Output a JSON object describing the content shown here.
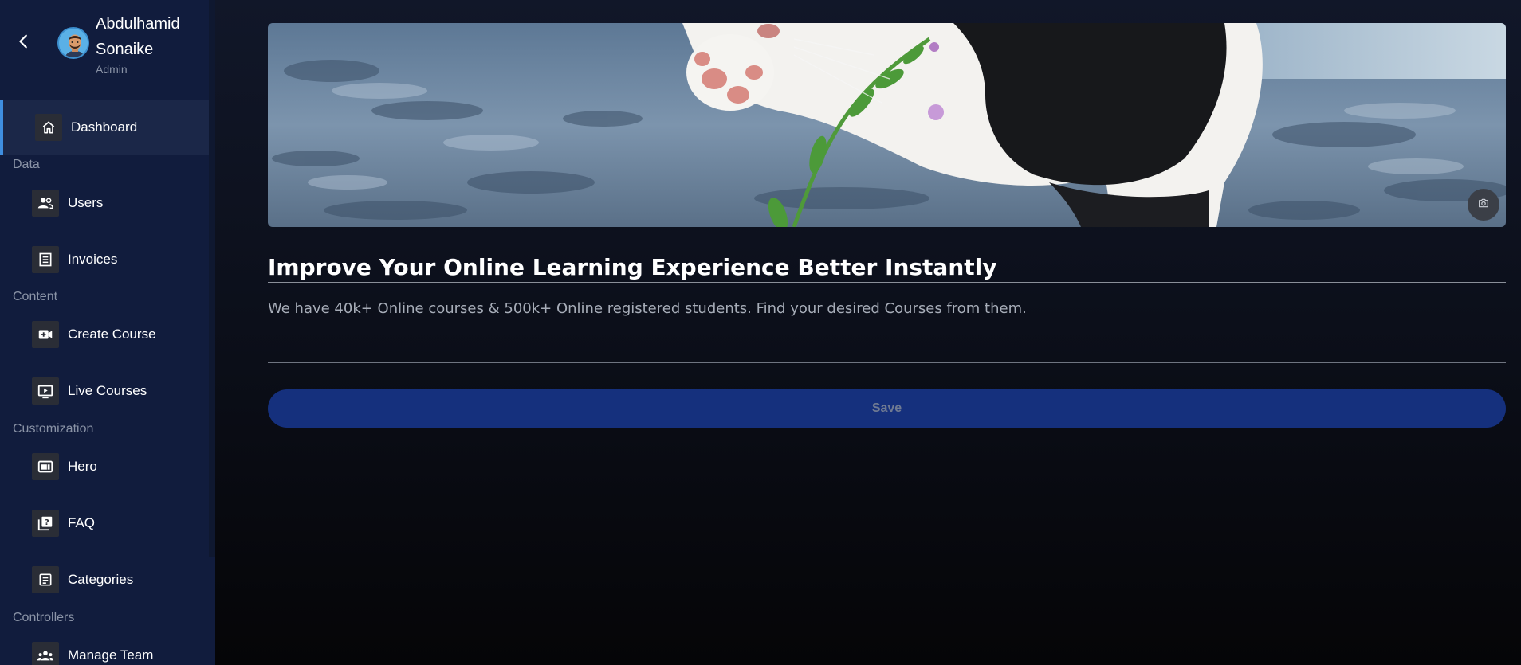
{
  "profile": {
    "name": "Abdulhamid Sonaike",
    "role": "Admin"
  },
  "sidebar": {
    "items": [
      {
        "label": "Dashboard",
        "icon": "home-icon",
        "active": true
      },
      {
        "section": "Data"
      },
      {
        "label": "Users",
        "icon": "users-icon"
      },
      {
        "label": "Invoices",
        "icon": "invoice-icon"
      },
      {
        "section": "Content"
      },
      {
        "label": "Create Course",
        "icon": "video-add-icon"
      },
      {
        "label": "Live Courses",
        "icon": "live-tv-icon"
      },
      {
        "section": "Customization"
      },
      {
        "label": "Hero",
        "icon": "web-icon"
      },
      {
        "label": "FAQ",
        "icon": "quiz-icon"
      },
      {
        "label": "Categories",
        "icon": "category-icon"
      },
      {
        "section": "Controllers"
      },
      {
        "label": "Manage Team",
        "icon": "groups-icon"
      }
    ]
  },
  "hero": {
    "title": "Improve Your Online Learning Experience Better Instantly",
    "subtitle": "We have 40k+ Online courses & 500k+ Online registered students. Find your desired Courses from them.",
    "save_label": "Save",
    "camera_icon": "camera-icon"
  },
  "colors": {
    "sidebar_bg": "#111c3d",
    "active_accent": "#3f8ee0",
    "save_button": "#15307d"
  }
}
